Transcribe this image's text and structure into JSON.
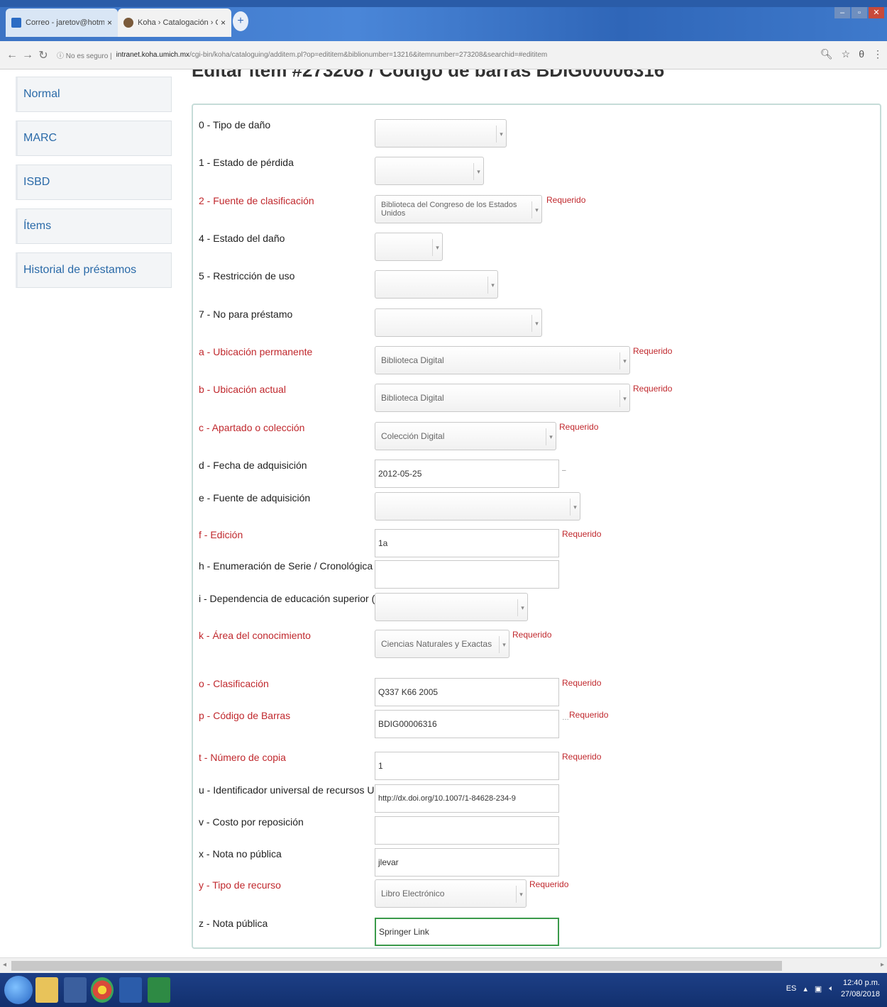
{
  "browser": {
    "tabs": [
      {
        "label": "Correo - jaretov@hotmail.com",
        "active": false
      },
      {
        "label": "Koha › Catalogación › Cognitive",
        "active": true
      }
    ],
    "security": "No es seguro",
    "url_host": "intranet.koha.umich.mx",
    "url_path": "/cgi-bin/koha/cataloguing/additem.pl?op=edititem&biblionumber=13216&itemnumber=273208&searchid=#edititem"
  },
  "page": {
    "heading": "Editar ítem #273208 / Código de barras BDIG00006316"
  },
  "sidebar": {
    "items": [
      {
        "label": "Normal"
      },
      {
        "label": "MARC"
      },
      {
        "label": "ISBD"
      },
      {
        "label": "Ítems"
      },
      {
        "label": "Historial de préstamos"
      }
    ]
  },
  "form": {
    "required_text": "Requerido",
    "fields": [
      {
        "label": "0 - Tipo de daño",
        "type": "select",
        "value": "",
        "required": false
      },
      {
        "label": "1 - Estado de pérdida",
        "type": "select",
        "value": "",
        "required": false
      },
      {
        "label": "2 - Fuente de clasificación",
        "type": "select",
        "value": "Biblioteca del Congreso de los Estados Unidos",
        "required": true
      },
      {
        "label": "4 - Estado del daño",
        "type": "select",
        "value": "",
        "required": false
      },
      {
        "label": "5 - Restricción de uso",
        "type": "select",
        "value": "",
        "required": false
      },
      {
        "label": "7 - No para préstamo",
        "type": "select",
        "value": "",
        "required": false
      },
      {
        "label": "a - Ubicación permanente",
        "type": "select",
        "value": "Biblioteca Digital",
        "required": true
      },
      {
        "label": "b - Ubicación actual",
        "type": "select",
        "value": "Biblioteca Digital",
        "required": true
      },
      {
        "label": "c - Apartado o colección",
        "type": "select",
        "value": "Colección Digital",
        "required": true
      },
      {
        "label": "d - Fecha de adquisición",
        "type": "input",
        "value": "2012-05-25",
        "required": false
      },
      {
        "label": "e - Fuente de adquisición",
        "type": "select",
        "value": "",
        "required": false
      },
      {
        "label": "f - Edición",
        "type": "input",
        "value": "1a",
        "required": true
      },
      {
        "label": "h - Enumeración de Serie / Cronológica",
        "type": "input",
        "value": "",
        "required": false
      },
      {
        "label": "i - Dependencia de educación superior (DES)",
        "type": "select",
        "value": "",
        "required": false
      },
      {
        "label": "k - Área del conocimiento",
        "type": "select",
        "value": "Ciencias Naturales y Exactas",
        "required": true
      },
      {
        "label": "o - Clasificación",
        "type": "input",
        "value": "Q337 K66 2005",
        "required": true
      },
      {
        "label": "p - Código de Barras",
        "type": "input",
        "value": "BDIG00006316",
        "required": true
      },
      {
        "label": "t - Número de copia",
        "type": "input",
        "value": "1",
        "required": true
      },
      {
        "label": "u - Identificador universal de recursos URL",
        "type": "input",
        "value": "http://dx.doi.org/10.1007/1-84628-234-9",
        "required": false
      },
      {
        "label": "v - Costo por reposición",
        "type": "input",
        "value": "",
        "required": false
      },
      {
        "label": "x - Nota no pública",
        "type": "input",
        "value": "jlevar",
        "required": false
      },
      {
        "label": "y - Tipo de recurso",
        "type": "select",
        "value": "Libro Electrónico",
        "required": true
      },
      {
        "label": "z - Nota pública",
        "type": "input",
        "value": "Springer Link",
        "required": false,
        "focused": true
      }
    ]
  },
  "taskbar": {
    "lang": "ES",
    "time": "12:40 p.m.",
    "date": "27/08/2018"
  }
}
